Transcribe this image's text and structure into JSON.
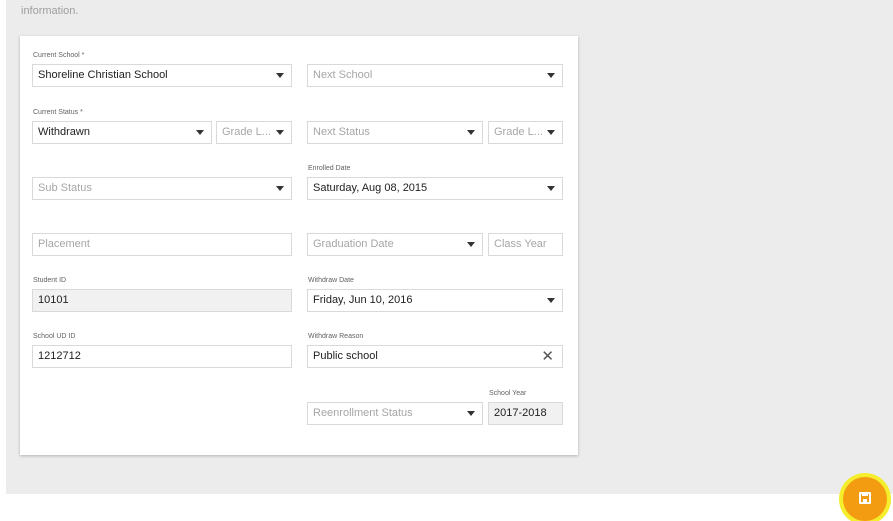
{
  "page": {
    "intro_text": "information.",
    "accent_color": "#f39c12",
    "highlight_color": "#f2f500"
  },
  "form": {
    "current_school": {
      "label": "Current School *",
      "value": "Shoreline Christian School"
    },
    "next_school": {
      "placeholder": "Next School"
    },
    "current_status": {
      "label": "Current Status *",
      "value": "Withdrawn"
    },
    "current_grade": {
      "placeholder": "Grade L..."
    },
    "next_status": {
      "placeholder": "Next Status"
    },
    "next_grade": {
      "placeholder": "Grade L..."
    },
    "sub_status": {
      "placeholder": "Sub Status"
    },
    "enrolled_date": {
      "label": "Enrolled Date",
      "value": "Saturday, Aug 08, 2015"
    },
    "placement": {
      "placeholder": "Placement"
    },
    "graduation_date": {
      "placeholder": "Graduation Date"
    },
    "class_year": {
      "placeholder": "Class Year"
    },
    "student_id": {
      "label": "Student ID",
      "value": "10101"
    },
    "withdraw_date": {
      "label": "Withdraw Date",
      "value": "Friday, Jun 10, 2016"
    },
    "school_ud_id": {
      "label": "School UD ID",
      "value": "1212712"
    },
    "withdraw_reason": {
      "label": "Withdraw Reason",
      "value": "Public school"
    },
    "reenrollment_status": {
      "placeholder": "Reenrollment Status"
    },
    "school_year": {
      "label": "School Year",
      "value": "2017-2018"
    }
  },
  "icons": {
    "save": "floppy-disk-icon",
    "dropdown": "caret-down-icon",
    "clear": "close-icon"
  }
}
